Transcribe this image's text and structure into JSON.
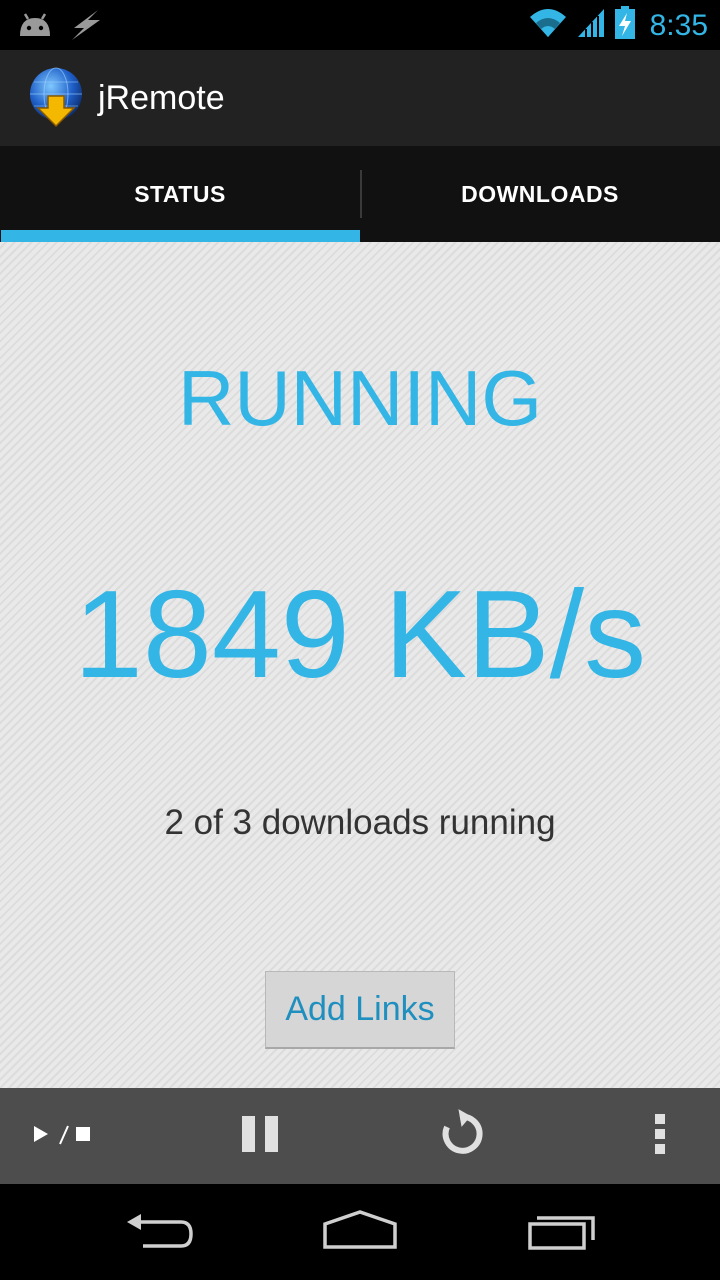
{
  "status_bar": {
    "time": "8:35",
    "icons": [
      "android-debug-icon",
      "usb-icon",
      "wifi-icon",
      "signal-icon",
      "battery-charging-icon"
    ]
  },
  "app": {
    "title": "jRemote",
    "icon": "globe-download-icon"
  },
  "tabs": [
    {
      "label": "STATUS",
      "selected": true
    },
    {
      "label": "DOWNLOADS",
      "selected": false
    }
  ],
  "status": {
    "state": "RUNNING",
    "speed": "1849 KB/s",
    "summary": "2 of 3 downloads running",
    "add_links_label": "Add Links"
  },
  "toolbar": {
    "play_stop_icon": "play-stop-icon",
    "pause_icon": "pause-icon",
    "refresh_icon": "refresh-icon",
    "overflow_icon": "overflow-menu-icon"
  },
  "nav": {
    "back_icon": "back-icon",
    "home_icon": "home-icon",
    "recent_icon": "recent-apps-icon"
  },
  "colors": {
    "accent": "#33b5e5",
    "action_bar": "#222222",
    "tab_bar": "#111111",
    "toolbar": "#4d4d4d",
    "content_bg": "#e6e6e6"
  }
}
